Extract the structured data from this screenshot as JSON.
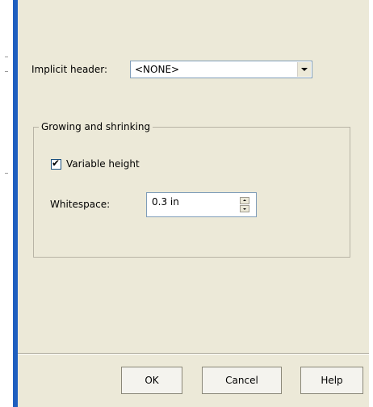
{
  "dialog": {
    "implicit_header": {
      "label": "Implicit header:",
      "selected": "<NONE>"
    },
    "growing_shrinking": {
      "title": "Growing and shrinking",
      "variable_height": {
        "label": "Variable height",
        "checked": true
      },
      "whitespace": {
        "label": "Whitespace:",
        "value": "0.3 in"
      }
    },
    "buttons": {
      "ok": "OK",
      "cancel": "Cancel",
      "help": "Help"
    }
  },
  "icons": {
    "checkbox_mark": "check-icon",
    "dropdown": "chevron-down-icon",
    "spin_up": "spin-up-icon",
    "spin_down": "spin-down-icon"
  },
  "colors": {
    "dialog_bg": "#ece9d8",
    "window_border": "#1f5fbf",
    "field_border": "#7f9db9"
  }
}
